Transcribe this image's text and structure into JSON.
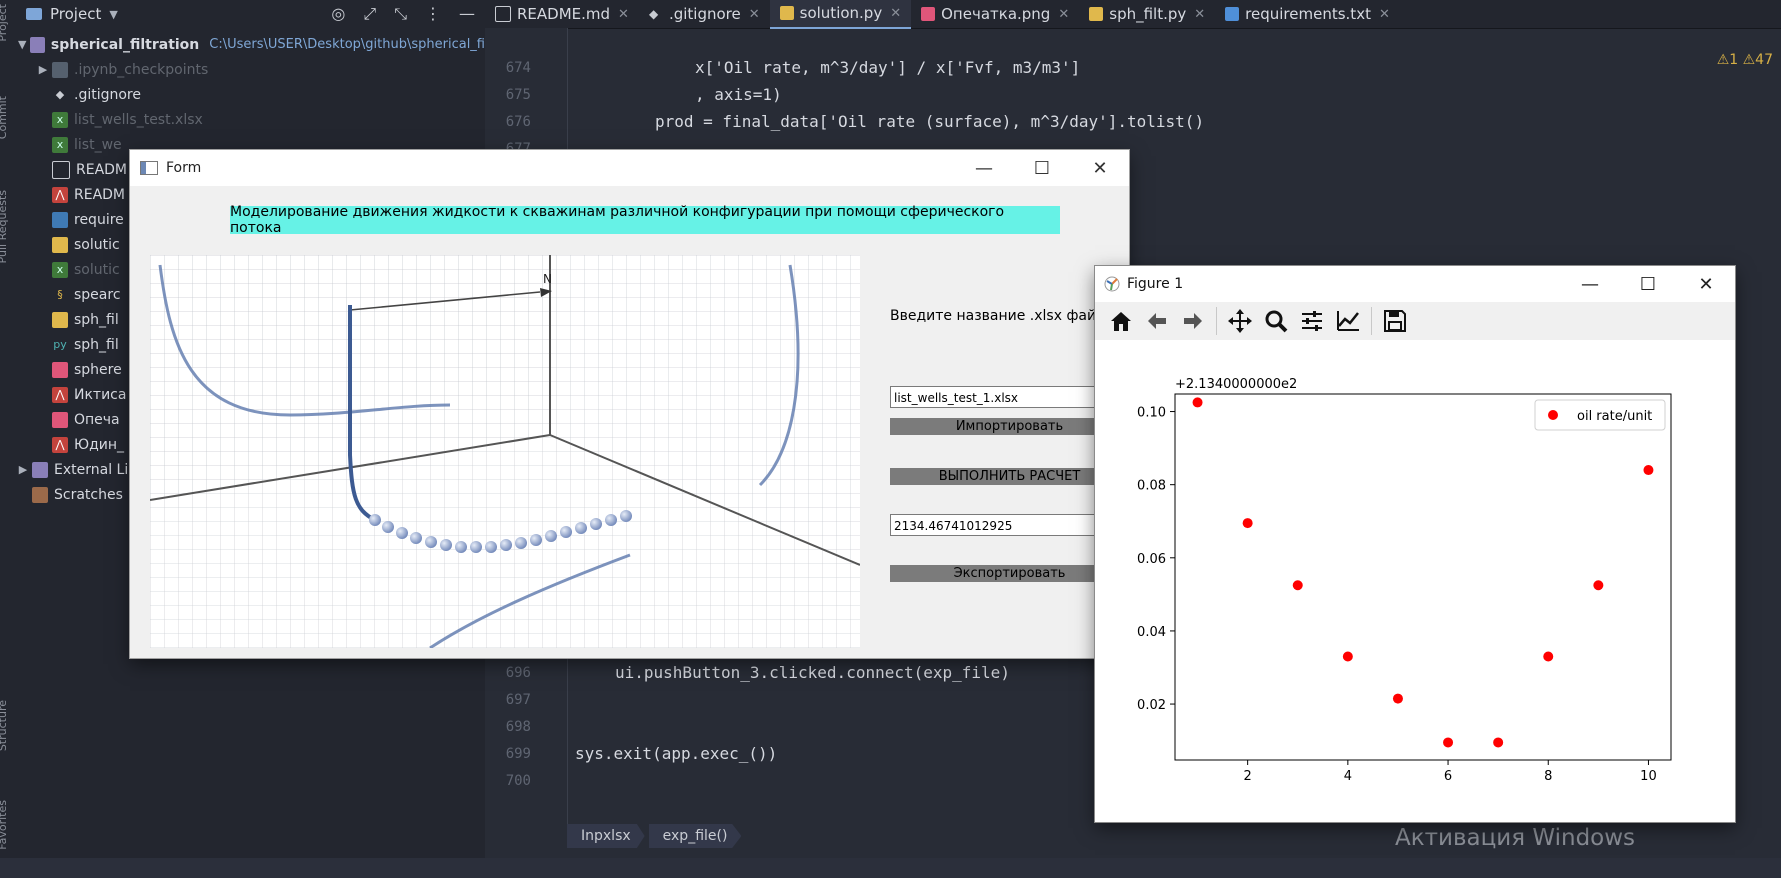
{
  "ide": {
    "side_tabs": [
      "Project",
      "Commit",
      "Pull Requests",
      "Structure",
      "Favorites"
    ],
    "project_panel": {
      "title": "Project",
      "root": "spherical_filtration",
      "root_path": "C:\\Users\\USER\\Desktop\\github\\spherical_fi",
      "items": [
        {
          "label": ".ipynb_checkpoints",
          "kind": "folder",
          "dim": true
        },
        {
          "label": ".gitignore",
          "kind": "git"
        },
        {
          "label": "list_wells_test.xlsx",
          "kind": "xlsx",
          "dim": true
        },
        {
          "label": "list_we",
          "kind": "xlsx",
          "dim": true
        },
        {
          "label": "READM",
          "kind": "md"
        },
        {
          "label": "READM",
          "kind": "pdf"
        },
        {
          "label": "require",
          "kind": "py"
        },
        {
          "label": "solutic",
          "kind": "py"
        },
        {
          "label": "solutic",
          "kind": "xlsx",
          "dim": true
        },
        {
          "label": "spearc",
          "kind": "py"
        },
        {
          "label": "sph_fil",
          "kind": "py"
        },
        {
          "label": "sph_fil",
          "kind": "py"
        },
        {
          "label": "sphere",
          "kind": "png"
        },
        {
          "label": "Иктиса",
          "kind": "pdf"
        },
        {
          "label": "Опеча",
          "kind": "png"
        },
        {
          "label": "Юдин_",
          "kind": "pdf"
        }
      ],
      "external": "External Li",
      "scratches": "Scratches"
    },
    "tabs": [
      {
        "label": "README.md",
        "color": "#c9ccd3"
      },
      {
        "label": ".gitignore",
        "color": "#c9ccd3"
      },
      {
        "label": "solution.py",
        "color": "#e0b84c"
      },
      {
        "label": "Опечатка.png",
        "color": "#e0567a"
      },
      {
        "label": "sph_filt.py",
        "color": "#e0b84c"
      },
      {
        "label": "requirements.txt",
        "color": "#4f8fd8"
      }
    ],
    "warnings": "⚠1  ⚠47",
    "line_numbers": [
      "674",
      "675",
      "676",
      "677",
      "696",
      "697",
      "698",
      "699",
      "700"
    ],
    "code": {
      "l674": "x['Oil rate, m^3/day'] / x['Fvf, m3/m3']",
      "l675": ", axis=1)",
      "l676": "prod = final_data['Oil rate (surface), m^3/day'].tolist()",
      "l696": "ui.pushButton_3.clicked.connect(exp_file)",
      "l699": "sys.exit(app.exec_())"
    },
    "breadcrumb": [
      "Inpxlsx",
      "exp_file()"
    ],
    "activate_windows": "Активация Windows"
  },
  "form": {
    "title": "Form",
    "heading": "Моделирование движения жидкости к скважинам различной конфигурации при помощи сферического потока",
    "file_label": "Введите название .xlsx файл",
    "file_input": "list_wells_test_1.xlsx",
    "import_button": "Импортировать",
    "run_button": "ВЫПОЛНИТЬ РАСЧЕТ",
    "result_value": "2134.46741012925",
    "export_button": "Экспортировать",
    "image_axis_label": "N"
  },
  "figure": {
    "title": "Figure 1",
    "toolbar": [
      "home-icon",
      "back-icon",
      "forward-icon",
      "pan-icon",
      "zoom-icon",
      "configure-icon",
      "edit-curves-icon",
      "save-icon"
    ]
  },
  "chart_data": {
    "type": "scatter",
    "offset_text": "+2.1340000000e2",
    "x": [
      1,
      2,
      3,
      4,
      5,
      6,
      7,
      8,
      9,
      10
    ],
    "series": [
      {
        "name": "oil rate/unit",
        "color": "#ff0000",
        "values": [
          0.1025,
          0.0695,
          0.0525,
          0.033,
          0.0215,
          0.0095,
          0.0095,
          0.033,
          0.0525,
          0.084
        ]
      }
    ],
    "xlim": [
      0.55,
      10.45
    ],
    "ylim": [
      0.0047,
      0.1048
    ],
    "xticks": [
      "2",
      "4",
      "6",
      "8",
      "10"
    ],
    "yticks": [
      "0.02",
      "0.04",
      "0.06",
      "0.08",
      "0.10"
    ],
    "legend_position": "upper right",
    "grid": false
  }
}
